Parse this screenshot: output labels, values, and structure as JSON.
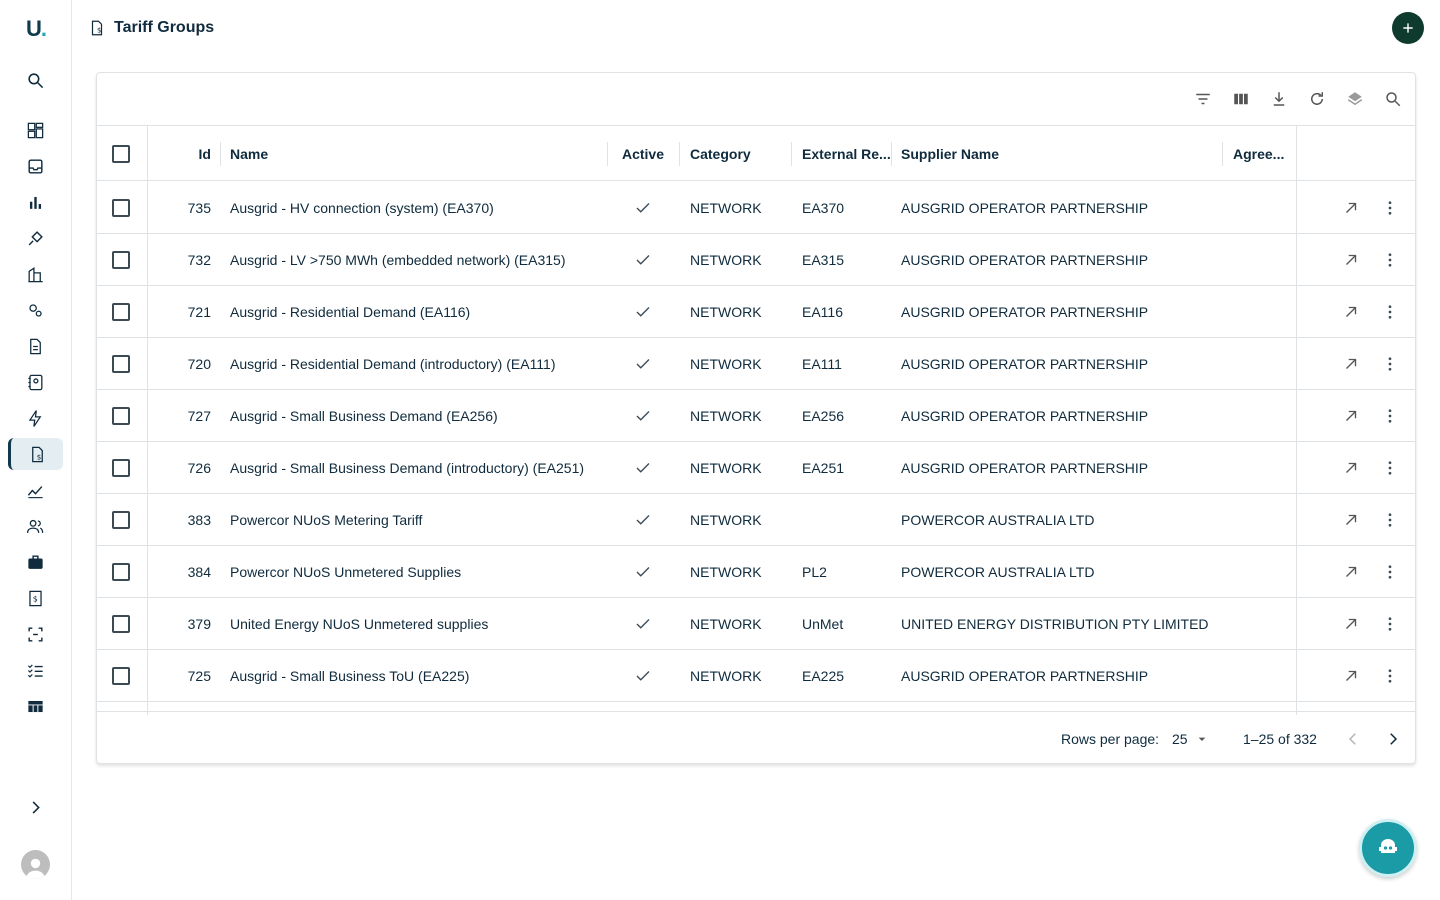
{
  "app": {
    "logo_letter": "U",
    "logo_dot": "."
  },
  "header": {
    "title": "Tariff Groups",
    "add_label": "+"
  },
  "sidebar": {
    "items": [
      {
        "icon": "search-icon"
      },
      {
        "icon": "dashboard-icon"
      },
      {
        "icon": "inbox-icon"
      },
      {
        "icon": "bar-chart-icon"
      },
      {
        "icon": "plug-icon"
      },
      {
        "icon": "building-icon"
      },
      {
        "icon": "location-icon"
      },
      {
        "icon": "document-icon"
      },
      {
        "icon": "contacts-icon"
      },
      {
        "icon": "bolt-icon"
      },
      {
        "icon": "tariff-icon",
        "active": true
      },
      {
        "icon": "trend-icon"
      },
      {
        "icon": "people-icon"
      },
      {
        "icon": "briefcase-icon"
      },
      {
        "icon": "invoice-icon"
      },
      {
        "icon": "scan-icon"
      },
      {
        "icon": "checklist-icon"
      },
      {
        "icon": "table-icon"
      }
    ],
    "expand_icon": "chevron-right-icon",
    "avatar_icon": "person-icon"
  },
  "toolbar": [
    "filter-icon",
    "columns-icon",
    "download-icon",
    "refresh-icon",
    "layers-icon",
    "search-icon"
  ],
  "table": {
    "columns": {
      "id": "Id",
      "name": "Name",
      "active": "Active",
      "category": "Category",
      "external": "External Re...",
      "supplier": "Supplier Name",
      "agree": "Agree..."
    },
    "rows": [
      {
        "id": "735",
        "name": "Ausgrid - HV connection (system) (EA370)",
        "category": "NETWORK",
        "external": "EA370",
        "supplier": "AUSGRID OPERATOR PARTNERSHIP"
      },
      {
        "id": "732",
        "name": "Ausgrid - LV >750 MWh (embedded network) (EA315)",
        "category": "NETWORK",
        "external": "EA315",
        "supplier": "AUSGRID OPERATOR PARTNERSHIP"
      },
      {
        "id": "721",
        "name": "Ausgrid - Residential Demand (EA116)",
        "category": "NETWORK",
        "external": "EA116",
        "supplier": "AUSGRID OPERATOR PARTNERSHIP"
      },
      {
        "id": "720",
        "name": "Ausgrid - Residential Demand (introductory) (EA111)",
        "category": "NETWORK",
        "external": "EA111",
        "supplier": "AUSGRID OPERATOR PARTNERSHIP"
      },
      {
        "id": "727",
        "name": "Ausgrid - Small Business Demand (EA256)",
        "category": "NETWORK",
        "external": "EA256",
        "supplier": "AUSGRID OPERATOR PARTNERSHIP"
      },
      {
        "id": "726",
        "name": "Ausgrid - Small Business Demand (introductory) (EA251)",
        "category": "NETWORK",
        "external": "EA251",
        "supplier": "AUSGRID OPERATOR PARTNERSHIP"
      },
      {
        "id": "383",
        "name": "Powercor NUoS Metering Tariff",
        "category": "NETWORK",
        "external": "",
        "supplier": "POWERCOR AUSTRALIA LTD"
      },
      {
        "id": "384",
        "name": "Powercor NUoS Unmetered Supplies",
        "category": "NETWORK",
        "external": "PL2",
        "supplier": "POWERCOR AUSTRALIA LTD"
      },
      {
        "id": "379",
        "name": "United Energy NUoS Unmetered supplies",
        "category": "NETWORK",
        "external": "UnMet",
        "supplier": "UNITED ENERGY DISTRIBUTION PTY LIMITED"
      },
      {
        "id": "725",
        "name": "Ausgrid - Small Business ToU (EA225)",
        "category": "NETWORK",
        "external": "EA225",
        "supplier": "AUSGRID OPERATOR PARTNERSHIP"
      }
    ]
  },
  "pagination": {
    "rows_per_page_label": "Rows per page:",
    "rows_per_page": "25",
    "range": "1–25 of 332"
  }
}
